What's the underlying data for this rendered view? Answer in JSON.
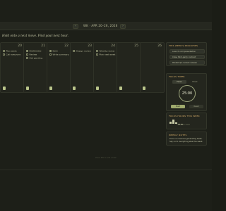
{
  "header": {
    "prev_label": "‹",
    "next_label": "›",
    "range_label": "WK · APR 20–26, 2026"
  },
  "banner": {
    "message": "Hold onto a next move. Find your next hour.",
    "muted": "on your side"
  },
  "board": {
    "columns": [
      {
        "day": "20",
        "tasks": [
          {
            "text": "Plan week",
            "done": false
          },
          {
            "text": "Call everyone",
            "done": false
          }
        ]
      },
      {
        "day": "21",
        "tasks": [
          {
            "text": "Draft notes",
            "done": true
          },
          {
            "text": "Review",
            "done": false
          },
          {
            "text": "Get pending",
            "done": false
          }
        ]
      },
      {
        "day": "22",
        "tasks": [
          {
            "text": "Sync",
            "done": true
          },
          {
            "text": "Write summary",
            "done": false
          }
        ]
      },
      {
        "day": "23",
        "tasks": [
          {
            "text": "Design review",
            "done": false
          }
        ]
      },
      {
        "day": "24",
        "tasks": [
          {
            "text": "Weekly review",
            "done": false
          },
          {
            "text": "Plan next week",
            "done": false
          }
        ]
      },
      {
        "day": "25",
        "tasks": []
      },
      {
        "day": "26",
        "tasks": []
      }
    ]
  },
  "sidebar": {
    "quick_title": "THIS WEEK'S PRIORITIES",
    "quick_items": [
      "Launch v2.0 presentation",
      "Close third-party contract",
      "Publish Q2 content release"
    ],
    "timer_title": "FOCUS TIMER",
    "timer_modes": [
      "Focus",
      "Break"
    ],
    "timer_value": "25:00",
    "start_label": "Start",
    "reset_label": "Reset",
    "chart_title": "FOCUS HOURS THIS WEEK",
    "chart_hint": "6 hrs this week",
    "chart_values": [
      0.5,
      0.9,
      0.35,
      0.0,
      0.0
    ],
    "note_title": "WEEKLY NOTES",
    "note_text": "Focus on revenue-generating tasks. Say no to everything else this week."
  },
  "footer": {
    "text": "Press ⌘K to add a task"
  },
  "colors": {
    "accent": "#9faa6d",
    "heading": "#d9b06a",
    "background": "#1d1f18"
  }
}
